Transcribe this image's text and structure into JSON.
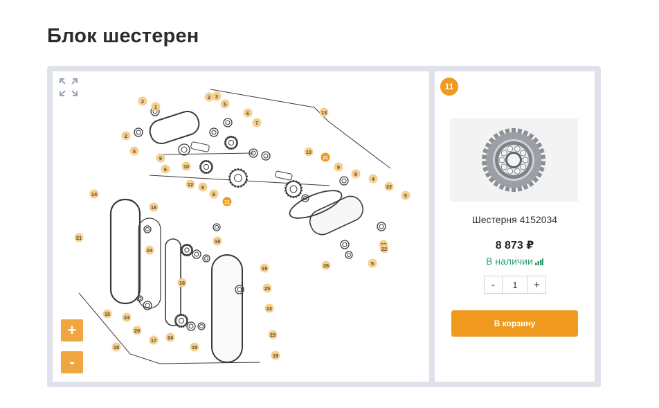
{
  "page": {
    "title": "Блок шестерен"
  },
  "diagram": {
    "callouts": [
      "2",
      "1",
      "2",
      "5",
      "3",
      "13",
      "6",
      "7",
      "2",
      "5",
      "9",
      "6",
      "10",
      "12",
      "9",
      "10",
      "11",
      "9",
      "8",
      "4",
      "22",
      "5",
      "6",
      "11",
      "14",
      "18",
      "21",
      "24",
      "16",
      "18",
      "19",
      "25",
      "22",
      "23",
      "19",
      "18",
      "15",
      "24",
      "20",
      "17",
      "24",
      "18",
      "26",
      "22",
      "22",
      "5"
    ],
    "selected_callout": "11",
    "colors": {
      "badge": "#f5cf8e",
      "selected_badge": "#ef9a1f",
      "line": "#3a3a3a"
    }
  },
  "controls": {
    "expand_icon": "expand-icon",
    "zoom_in": "+",
    "zoom_out": "-"
  },
  "product": {
    "badge": "11",
    "name": "Шестерня 4152034",
    "price": "8 873 ₽",
    "stock": "В наличии",
    "quantity": "1",
    "minus_label": "-",
    "plus_label": "+",
    "cart_label": "В корзину",
    "accent": "#ef9a1f",
    "stock_color": "#2f9e6e"
  }
}
